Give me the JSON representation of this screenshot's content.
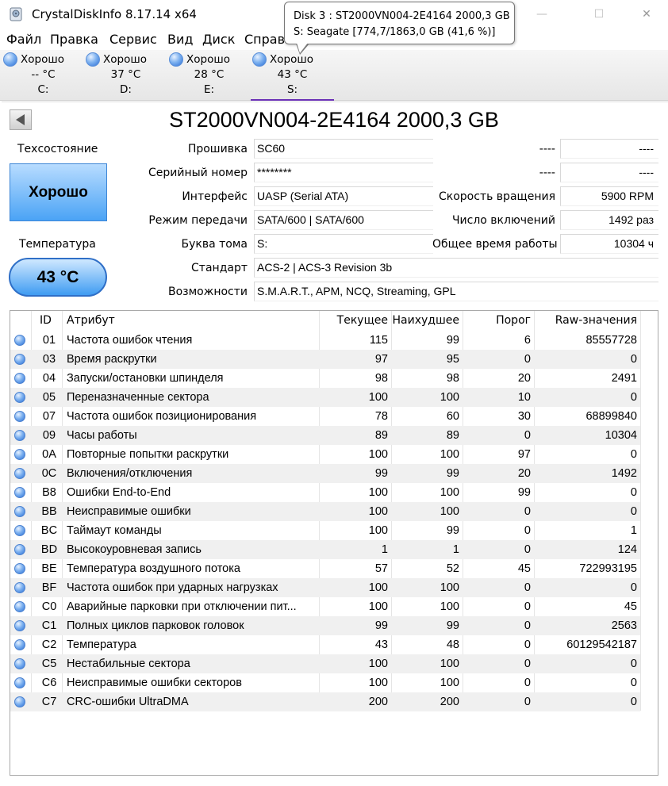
{
  "window": {
    "title": "CrystalDiskInfo 8.17.14 x64",
    "minimize": "—",
    "maximize": "☐",
    "close": "✕"
  },
  "menu": [
    "Файл",
    "Правка",
    "Сервис",
    "Вид",
    "Диск",
    "Справка"
  ],
  "tooltip": {
    "line1": "Disk 3 : ST2000VN004-2E4164 2000,3 GB",
    "line2": "S: Seagate [774,7/1863,0 GB (41,6 %)]"
  },
  "drives": [
    {
      "status": "Хорошо",
      "temp": "-- °C",
      "letter": "C:"
    },
    {
      "status": "Хорошо",
      "temp": "37 °C",
      "letter": "D:"
    },
    {
      "status": "Хорошо",
      "temp": "28 °C",
      "letter": "E:"
    },
    {
      "status": "Хорошо",
      "temp": "43 °C",
      "letter": "S:"
    }
  ],
  "disk": {
    "model": "ST2000VN004-2E4164 2000,3 GB",
    "health_label": "Техсостояние",
    "health": "Хорошо",
    "temp_label": "Температура",
    "temp": "43 °C"
  },
  "fields": {
    "firmware": {
      "label": "Прошивка",
      "value": "SC60"
    },
    "serial": {
      "label": "Серийный номер",
      "value": "********"
    },
    "interface": {
      "label": "Интерфейс",
      "value": "UASP (Serial ATA)"
    },
    "transfer": {
      "label": "Режим передачи",
      "value": "SATA/600 | SATA/600"
    },
    "volume": {
      "label": "Буква тома",
      "value": "S:"
    },
    "standard": {
      "label": "Стандарт",
      "value": "ACS-2 | ACS-3 Revision 3b"
    },
    "features": {
      "label": "Возможности",
      "value": "S.M.A.R.T., APM, NCQ, Streaming, GPL"
    },
    "blank1": {
      "label": "----",
      "value": "----"
    },
    "blank2": {
      "label": "----",
      "value": "----"
    },
    "rotation": {
      "label": "Скорость вращения",
      "value": "5900 RPM"
    },
    "power_count": {
      "label": "Число включений",
      "value": "1492 раз"
    },
    "power_hours": {
      "label": "Общее время работы",
      "value": "10304 ч"
    }
  },
  "table": {
    "headers": [
      "ID",
      "Атрибут",
      "Текущее",
      "Наихудшее",
      "Порог",
      "Raw-значения"
    ],
    "rows": [
      [
        "01",
        "Частота ошибок чтения",
        "115",
        "99",
        "6",
        "85557728"
      ],
      [
        "03",
        "Время раскрутки",
        "97",
        "95",
        "0",
        "0"
      ],
      [
        "04",
        "Запуски/остановки шпинделя",
        "98",
        "98",
        "20",
        "2491"
      ],
      [
        "05",
        "Переназначенные сектора",
        "100",
        "100",
        "10",
        "0"
      ],
      [
        "07",
        "Частота ошибок позиционирования",
        "78",
        "60",
        "30",
        "68899840"
      ],
      [
        "09",
        "Часы работы",
        "89",
        "89",
        "0",
        "10304"
      ],
      [
        "0A",
        "Повторные попытки раскрутки",
        "100",
        "100",
        "97",
        "0"
      ],
      [
        "0C",
        "Включения/отключения",
        "99",
        "99",
        "20",
        "1492"
      ],
      [
        "B8",
        "Ошибки End-to-End",
        "100",
        "100",
        "99",
        "0"
      ],
      [
        "BB",
        "Неисправимые ошибки",
        "100",
        "100",
        "0",
        "0"
      ],
      [
        "BC",
        "Таймаут команды",
        "100",
        "99",
        "0",
        "1"
      ],
      [
        "BD",
        "Высокоуровневая запись",
        "1",
        "1",
        "0",
        "124"
      ],
      [
        "BE",
        "Температура воздушного потока",
        "57",
        "52",
        "45",
        "722993195"
      ],
      [
        "BF",
        "Частота ошибок при ударных нагрузках",
        "100",
        "100",
        "0",
        "0"
      ],
      [
        "C0",
        "Аварийные парковки при отключении пит...",
        "100",
        "100",
        "0",
        "45"
      ],
      [
        "C1",
        "Полных циклов парковок головок",
        "99",
        "99",
        "0",
        "2563"
      ],
      [
        "C2",
        "Температура",
        "43",
        "48",
        "0",
        "60129542187"
      ],
      [
        "C5",
        "Нестабильные сектора",
        "100",
        "100",
        "0",
        "0"
      ],
      [
        "C6",
        "Неисправимые ошибки секторов",
        "100",
        "100",
        "0",
        "0"
      ],
      [
        "C7",
        "CRC-ошибки UltraDMA",
        "200",
        "200",
        "0",
        "0"
      ]
    ]
  }
}
